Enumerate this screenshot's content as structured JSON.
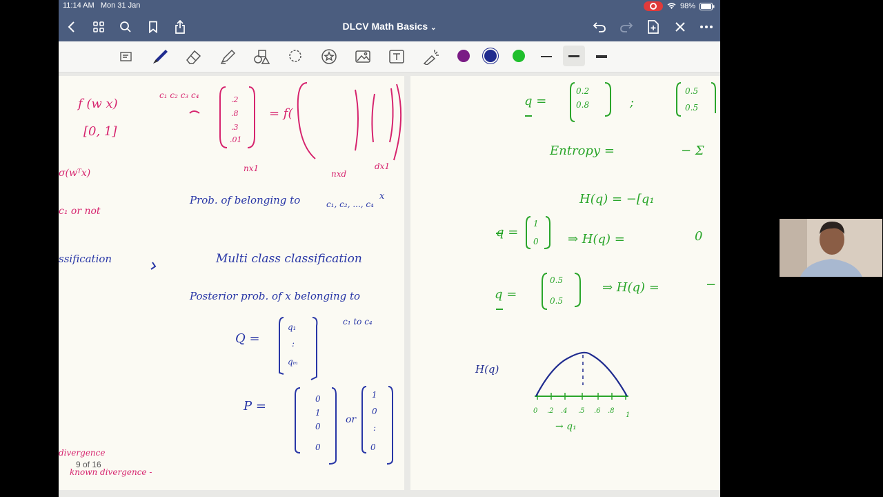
{
  "status": {
    "time": "11:14 AM",
    "date": "Mon 31 Jan",
    "battery": "98%"
  },
  "nav": {
    "title": "DLCV Math Basics"
  },
  "page_indicator": "9 of 16",
  "colors": {
    "purple": "#7a1c85",
    "navy": "#1f2b8f",
    "green": "#1fbf2c",
    "nav_bg": "#4b5d7f",
    "pink": "#d6246e",
    "blue_ink": "#2836a6",
    "green_ink": "#2aa52a"
  },
  "notes_left": {
    "f": "f (w x)",
    "range": "[0, 1]",
    "c_labels": "c₁ c₂ c₃ c₄",
    "vec": [
      ".2",
      ".8",
      ".3",
      ".01"
    ],
    "eq_f": "= f(",
    "nx1": "nx1",
    "nxd": "nxd",
    "dx1": "dx1",
    "prob": "Prob. of belonging to",
    "classes": "c₁, c₂, ..., c₄",
    "x_mark": "x",
    "sig": "σ(wᵀx)",
    "or_not": "c₁ or not",
    "fication": "ssification",
    "multiclass": "Multi class classification",
    "posterior": "Posterior prob. of x belonging to",
    "c1c4": "c₁ to c₄",
    "Q": "Q =",
    "qvec": [
      "q₁",
      ":",
      "qₘ"
    ],
    "P": "P =",
    "pvec": [
      "0",
      "1",
      "0",
      "0"
    ],
    "or": "or",
    "pvec2": [
      "1",
      "0",
      ":",
      "0"
    ],
    "divergence": "divergence",
    "kl": "known divergence -"
  },
  "notes_right": {
    "q_eq": "q =",
    "qv": [
      "0.2",
      "0.8"
    ],
    "semi": ";",
    "qv2": [
      "0.5",
      "0.5"
    ],
    "entropy": "Entropy =",
    "minus_sum": "− Σ",
    "Hq": "H(q) = −[q₁",
    "q1": "q =",
    "qv3": [
      "1",
      "0"
    ],
    "arrow1": "⇒ H(q) =",
    "zero": "0",
    "q2": "q =",
    "qv4": [
      "0.5",
      "0.5"
    ],
    "arrow2": "⇒ H(q) =",
    "minus": "−",
    "Hq_label": "H(q)",
    "axis_ticks": [
      "0",
      ".2",
      ".4",
      ".5",
      ".6",
      ".8",
      "1"
    ],
    "axis_label": "→ q₁"
  }
}
